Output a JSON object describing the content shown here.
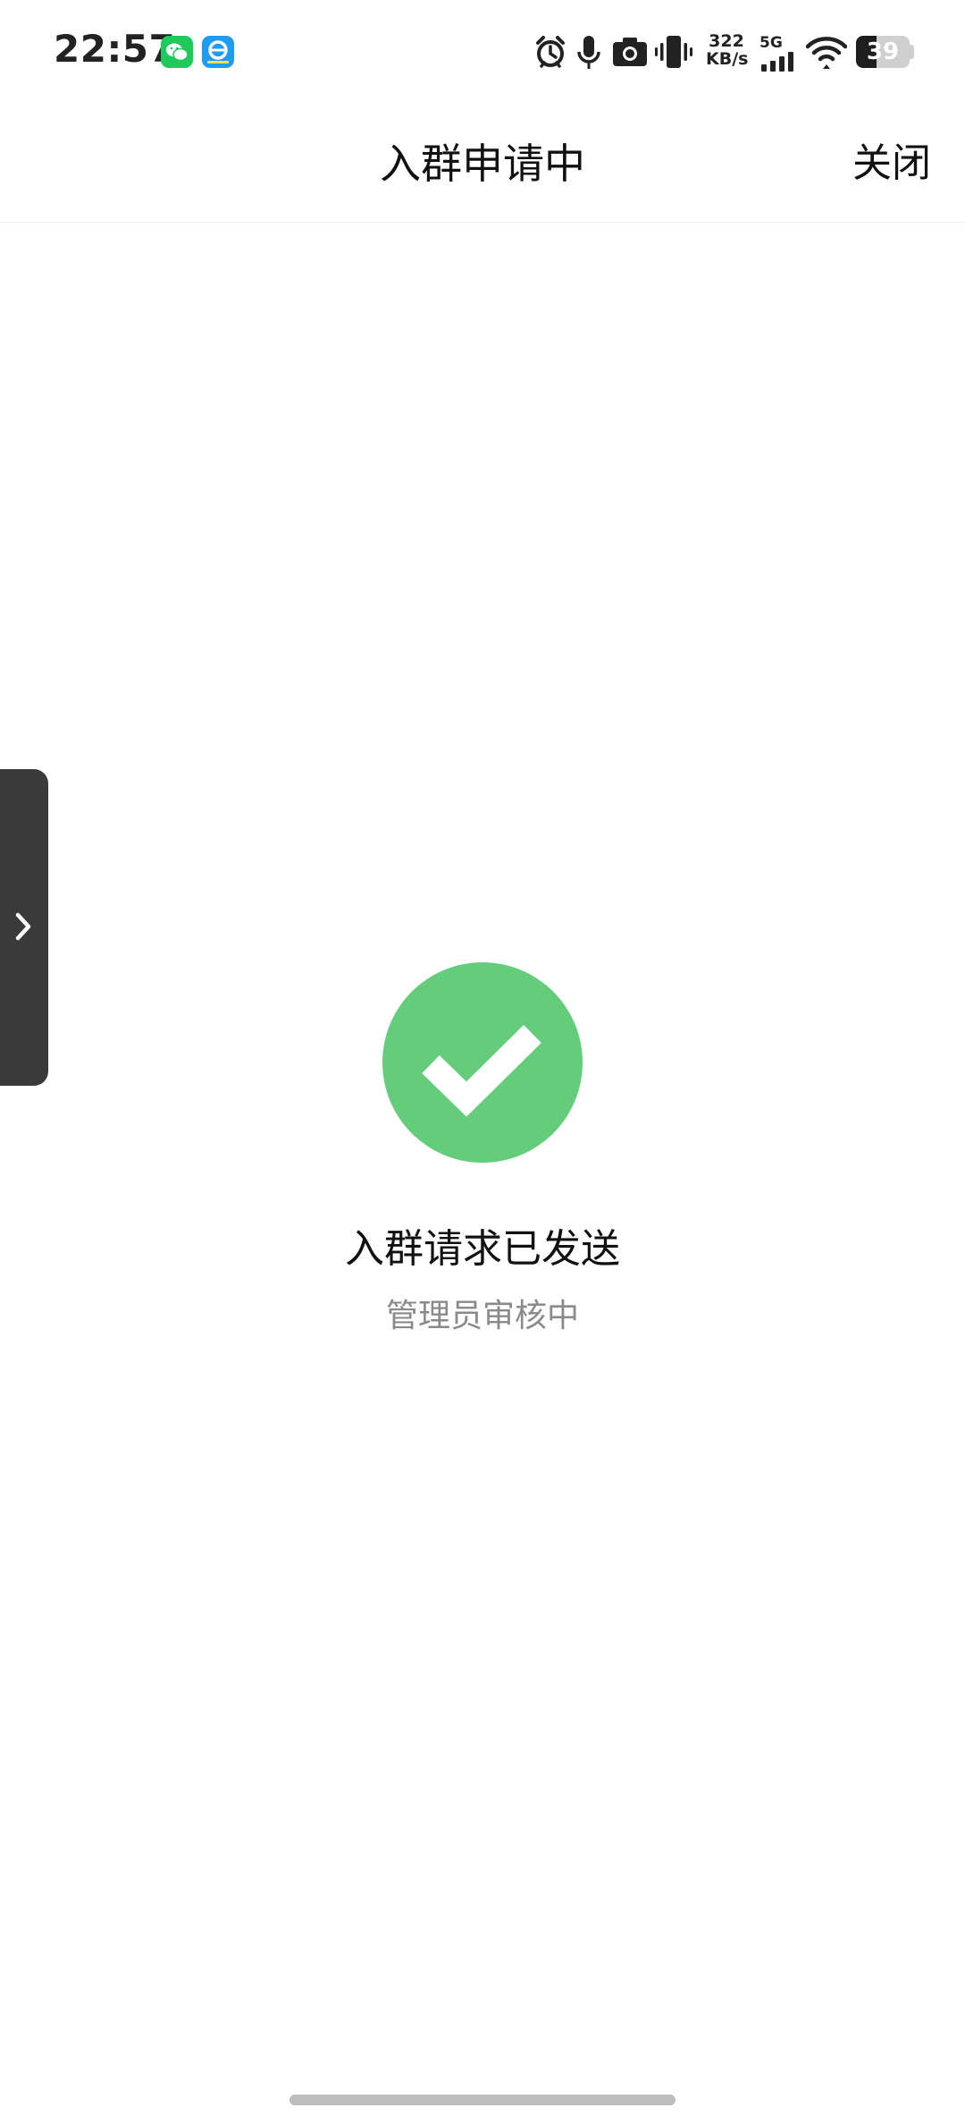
{
  "status_bar": {
    "time": "22:57",
    "net_speed_value": "322",
    "net_speed_unit": "KB/s",
    "network_type": "5G",
    "battery_level": "39",
    "battery_fraction": 0.39,
    "icons": [
      "wechat-icon",
      "eleme-icon",
      "alarm-icon",
      "microphone-icon",
      "camera-icon",
      "vibrate-icon",
      "signal-icon",
      "wifi-icon",
      "battery-icon"
    ]
  },
  "nav": {
    "title": "入群申请中",
    "close_label": "关闭"
  },
  "result": {
    "title": "入群请求已发送",
    "subtitle": "管理员审核中",
    "icon": "check-icon",
    "color": "#64cd7c"
  },
  "side_tab": {
    "icon": "chevron-right-icon"
  }
}
